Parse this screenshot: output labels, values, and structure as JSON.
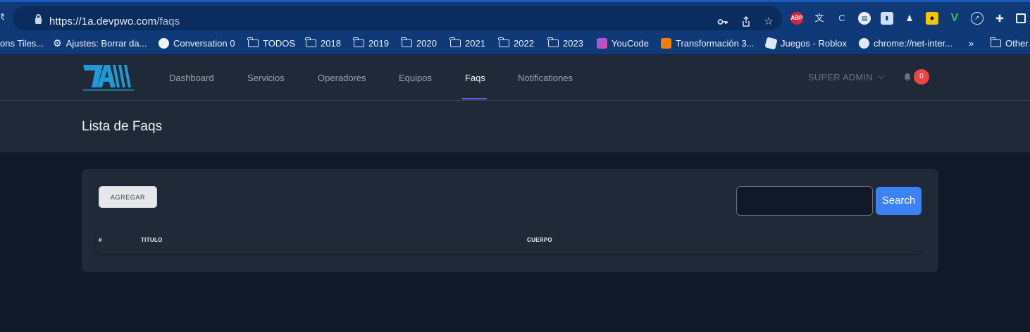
{
  "browser": {
    "url_host": "https://1a.devpwo.com",
    "url_path": "/faqs",
    "bookmarks": [
      {
        "label": "ons Tiles...",
        "icon": "partial-icon"
      },
      {
        "label": "Ajustes: Borrar da...",
        "icon": "gear-icon"
      },
      {
        "label": "Conversation 0",
        "icon": "github-icon"
      },
      {
        "label": "TODOS",
        "icon": "folder-icon"
      },
      {
        "label": "2018",
        "icon": "folder-icon"
      },
      {
        "label": "2019",
        "icon": "folder-icon"
      },
      {
        "label": "2020",
        "icon": "folder-icon"
      },
      {
        "label": "2021",
        "icon": "folder-icon"
      },
      {
        "label": "2022",
        "icon": "folder-icon"
      },
      {
        "label": "2023",
        "icon": "folder-icon"
      },
      {
        "label": "YouCode",
        "icon": "youcode-icon"
      },
      {
        "label": "Transformación 3...",
        "icon": "blogger-icon"
      },
      {
        "label": "Juegos - Roblox",
        "icon": "roblox-icon"
      },
      {
        "label": "chrome://net-inter...",
        "icon": "globe-icon"
      },
      {
        "label": "»",
        "icon": "overflow-icon"
      },
      {
        "label": "Other",
        "icon": "folder-icon"
      }
    ],
    "extensions": [
      "ABP"
    ]
  },
  "nav": {
    "links": [
      "Dashboard",
      "Servicios",
      "Operadores",
      "Equipos",
      "Faqs",
      "Notificationes"
    ],
    "active": "Faqs",
    "user": "SUPER ADMIN",
    "notification_count": "0"
  },
  "page": {
    "title": "Lista de Faqs"
  },
  "card": {
    "add_label": "AGREGAR",
    "search_value": "",
    "search_label": "Search",
    "columns": [
      "#",
      "TITULO",
      "CUERPO"
    ]
  },
  "colors": {
    "accent": "#6366f1",
    "search_button": "#3b82f6",
    "badge": "#ef4444",
    "chrome": "#0f3a77"
  }
}
